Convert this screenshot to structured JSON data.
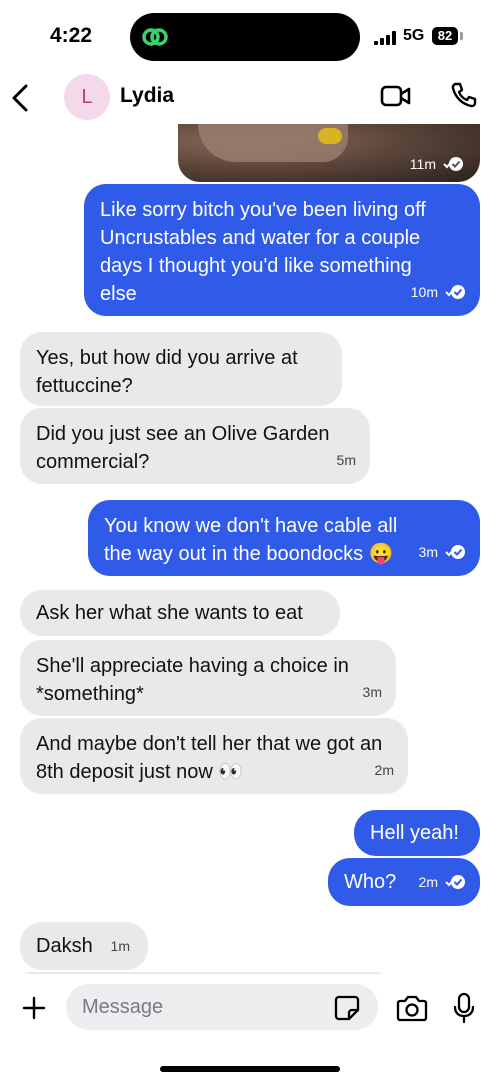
{
  "status_bar": {
    "time": "4:22",
    "network": "5G",
    "battery": "82"
  },
  "header": {
    "avatar_letter": "L",
    "contact_name": "Lydia"
  },
  "photo": {
    "time": "11m"
  },
  "messages": [
    {
      "direction": "outgoing",
      "text": "Like sorry bitch you've been living off Uncrustables and water for a couple days I thought you'd like something else",
      "time": "10m",
      "read": true
    },
    {
      "direction": "incoming",
      "text": "Yes, but how did you arrive at fettuccine?",
      "time": ""
    },
    {
      "direction": "incoming",
      "text": "Did you just see an Olive Garden commercial?",
      "time": "5m"
    },
    {
      "direction": "outgoing",
      "text": "You know we don't have cable all the way out in the boondocks 😛",
      "time": "3m",
      "read": true
    },
    {
      "direction": "incoming",
      "text": "Ask her what she wants to eat",
      "time": ""
    },
    {
      "direction": "incoming",
      "text": "She'll appreciate having a choice in *something*",
      "time": "3m"
    },
    {
      "direction": "incoming",
      "text": "And maybe don't tell her that we got an 8th deposit just now 👀",
      "time": "2m"
    },
    {
      "direction": "outgoing",
      "text": "Hell yeah!",
      "time": ""
    },
    {
      "direction": "outgoing",
      "text": "Who?",
      "time": "2m",
      "read": true
    },
    {
      "direction": "incoming",
      "text": "Daksh",
      "time": "1m"
    }
  ],
  "composer": {
    "placeholder": "Message"
  },
  "colors": {
    "outgoing": "#2f5be8",
    "incoming": "#e9e9eb",
    "avatar_bg": "#f4d9ea",
    "avatar_fg": "#c0368c"
  },
  "icons": [
    "link-icon",
    "back-icon",
    "video-call-icon",
    "phone-call-icon",
    "read-check-icon",
    "plus-icon",
    "sticker-icon",
    "camera-icon",
    "microphone-icon"
  ]
}
